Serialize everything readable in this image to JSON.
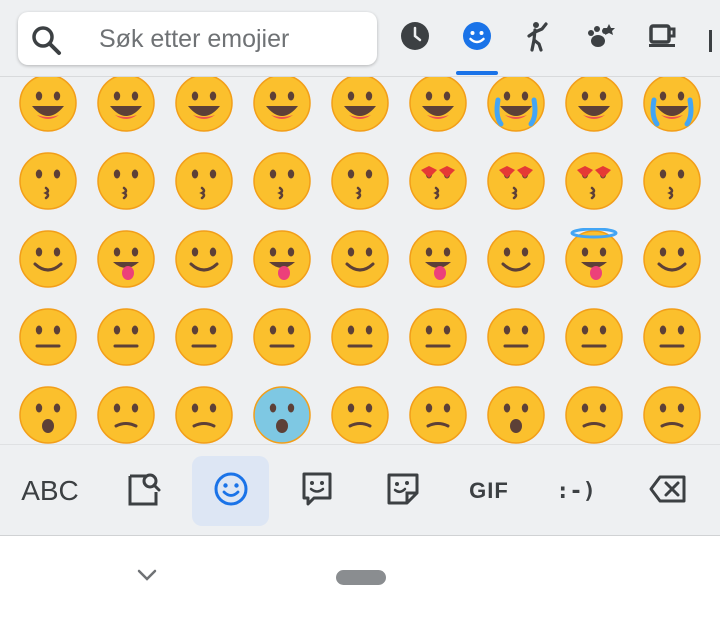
{
  "search": {
    "placeholder": "Søk etter emojier",
    "icon": "search-icon"
  },
  "categories": [
    {
      "name": "recent",
      "icon": "clock-icon",
      "selected": false
    },
    {
      "name": "smileys",
      "icon": "smiley-icon",
      "selected": true
    },
    {
      "name": "people",
      "icon": "person-icon",
      "selected": false
    },
    {
      "name": "animals-nature",
      "icon": "paw-icon",
      "selected": false
    },
    {
      "name": "food-drink",
      "icon": "cup-icon",
      "selected": false
    }
  ],
  "emoji_grid": {
    "rows": [
      [
        "😀",
        "😃",
        "😄",
        "😁",
        "😆",
        "😅",
        "😂",
        "🤣",
        "😭"
      ],
      [
        "😉",
        "😗",
        "😙",
        "😚",
        "😘",
        "🥰",
        "😍",
        "🤩",
        "🥳"
      ],
      [
        "🙃",
        "🙂",
        "😋",
        "😛",
        "😝",
        "😜",
        "🤪",
        "😇",
        "😊"
      ],
      [
        "☺️",
        "😏",
        "😌",
        "😔",
        "😑",
        "😐",
        "😶",
        "🤔",
        "🤫"
      ],
      [
        "🤭",
        "🥱",
        "🤗",
        "😱",
        "🤨",
        "🧐",
        "😒",
        "🙄",
        "😤"
      ]
    ]
  },
  "toolbar": {
    "abc_label": "ABC",
    "gif_label": "GIF",
    "emoticon_label": ":-)",
    "active_tab": "emoji"
  },
  "colors": {
    "accent": "#1a73e8",
    "background": "#eef0f2",
    "emoji_face": "#fbc02d"
  }
}
